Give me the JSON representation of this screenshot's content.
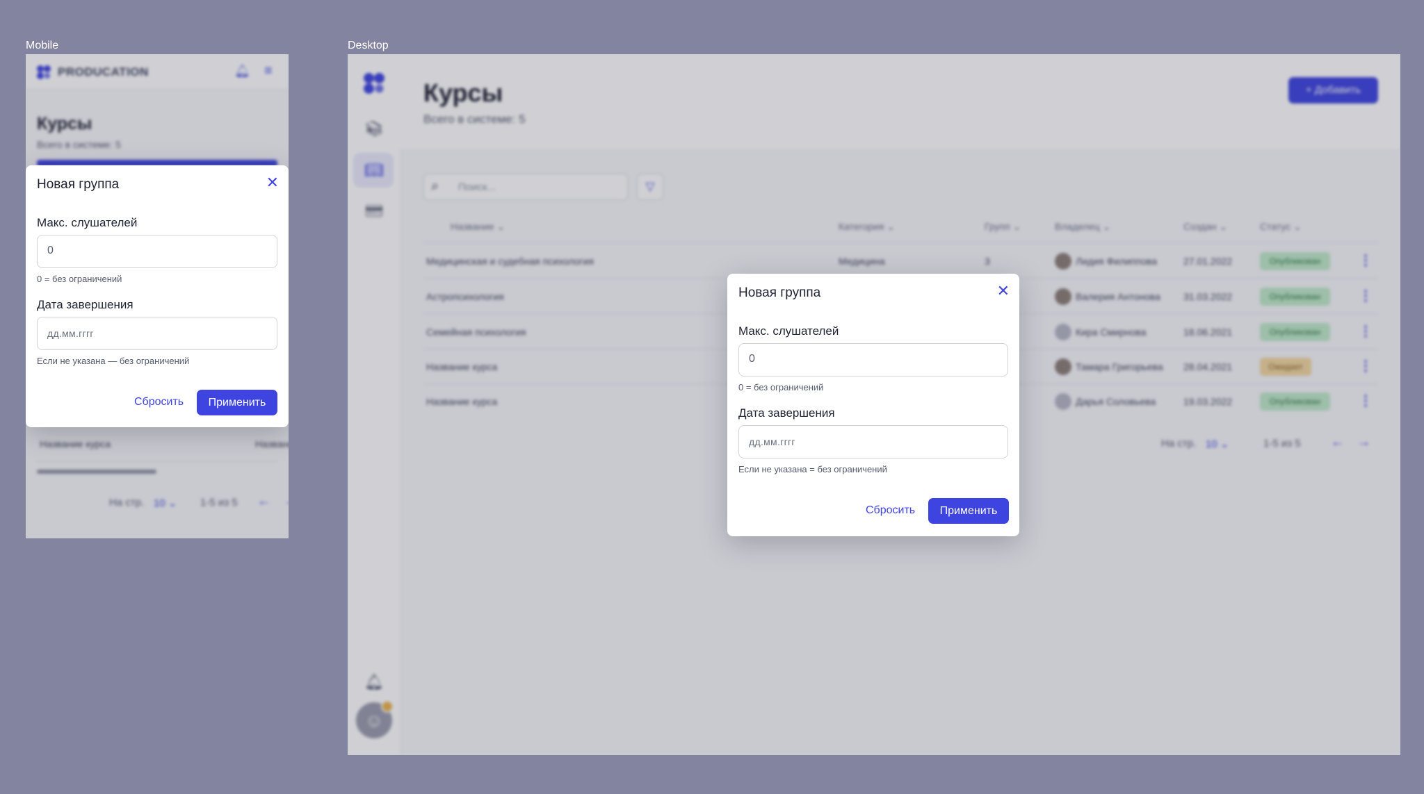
{
  "frames": {
    "mobile_label": "Mobile",
    "desktop_label": "Desktop"
  },
  "app": {
    "brand": "PRODUCATION"
  },
  "page": {
    "title": "Курсы",
    "total": "Всего в системе: 5",
    "add_button": "+ Добавить"
  },
  "search": {
    "placeholder": "Поиск..."
  },
  "table": {
    "columns": [
      "Название",
      "Категория",
      "Групп",
      "Владелец",
      "Создан",
      "Статус"
    ],
    "rows": [
      {
        "name": "Медицинская и судебная психология",
        "category": "Медицина",
        "groups": "3",
        "owner": "Лидия Филиппова",
        "created": "27.01.2022",
        "status": "Опубликован"
      },
      {
        "name": "Астропсихология",
        "category": "",
        "groups": "",
        "owner": "Валерия Антонова",
        "created": "31.03.2022",
        "status": "Опубликован"
      },
      {
        "name": "Семейная психология",
        "category": "",
        "groups": "",
        "owner": "Кира Смирнова",
        "created": "18.06.2021",
        "status": "Опубликован"
      },
      {
        "name": "Название курса",
        "category": "",
        "groups": "",
        "owner": "Тамара Григорьева",
        "created": "28.04.2021",
        "status": "Ожидает"
      },
      {
        "name": "Название курса",
        "category": "",
        "groups": "",
        "owner": "Дарья Соловьева",
        "created": "19.03.2022",
        "status": "Опубликован"
      }
    ]
  },
  "mobile_row": {
    "name": "Название курса",
    "second": "Название"
  },
  "pagination": {
    "per_page_label": "На стр.",
    "per_page_value": "10",
    "range": "1-5 из 5",
    "prev_icon": "arrow-left-icon",
    "next_icon": "arrow-right-icon"
  },
  "modal": {
    "title": "Новая группа",
    "max_listeners_label": "Макс. слушателей",
    "max_listeners_value": "0",
    "max_listeners_hint": "0 = без ограничений",
    "end_date_label": "Дата завершения",
    "end_date_placeholder": "дд.мм.гггг",
    "end_date_hint_mobile": "Если не указана — без ограничений",
    "end_date_hint_desktop": "Если не указана = без ограничений",
    "reset_button": "Сбросить",
    "apply_button": "Применить"
  },
  "colors": {
    "accent": "#3e44e0",
    "canvas": "#83849f",
    "published": "#bfe9c8",
    "pending": "#f1d6a1"
  }
}
